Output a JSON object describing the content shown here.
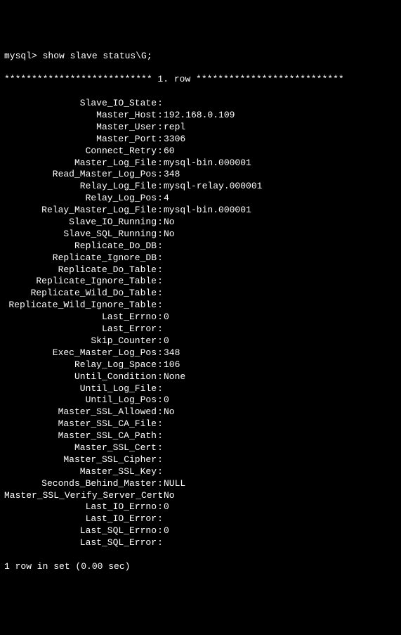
{
  "prompt": "mysql> show slave status\\G;",
  "row_header": "*************************** 1. row ***************************",
  "fields": [
    {
      "label": "Slave_IO_State",
      "value": ""
    },
    {
      "label": "Master_Host",
      "value": "192.168.0.109"
    },
    {
      "label": "Master_User",
      "value": "repl"
    },
    {
      "label": "Master_Port",
      "value": "3306"
    },
    {
      "label": "Connect_Retry",
      "value": "60"
    },
    {
      "label": "Master_Log_File",
      "value": "mysql-bin.000001"
    },
    {
      "label": "Read_Master_Log_Pos",
      "value": "348"
    },
    {
      "label": "Relay_Log_File",
      "value": "mysql-relay.000001"
    },
    {
      "label": "Relay_Log_Pos",
      "value": "4"
    },
    {
      "label": "Relay_Master_Log_File",
      "value": "mysql-bin.000001"
    },
    {
      "label": "Slave_IO_Running",
      "value": "No"
    },
    {
      "label": "Slave_SQL_Running",
      "value": "No"
    },
    {
      "label": "Replicate_Do_DB",
      "value": ""
    },
    {
      "label": "Replicate_Ignore_DB",
      "value": ""
    },
    {
      "label": "Replicate_Do_Table",
      "value": ""
    },
    {
      "label": "Replicate_Ignore_Table",
      "value": ""
    },
    {
      "label": "Replicate_Wild_Do_Table",
      "value": ""
    },
    {
      "label": "Replicate_Wild_Ignore_Table",
      "value": ""
    },
    {
      "label": "Last_Errno",
      "value": "0"
    },
    {
      "label": "Last_Error",
      "value": ""
    },
    {
      "label": "Skip_Counter",
      "value": "0"
    },
    {
      "label": "Exec_Master_Log_Pos",
      "value": "348"
    },
    {
      "label": "Relay_Log_Space",
      "value": "106"
    },
    {
      "label": "Until_Condition",
      "value": "None"
    },
    {
      "label": "Until_Log_File",
      "value": ""
    },
    {
      "label": "Until_Log_Pos",
      "value": "0"
    },
    {
      "label": "Master_SSL_Allowed",
      "value": "No"
    },
    {
      "label": "Master_SSL_CA_File",
      "value": ""
    },
    {
      "label": "Master_SSL_CA_Path",
      "value": ""
    },
    {
      "label": "Master_SSL_Cert",
      "value": ""
    },
    {
      "label": "Master_SSL_Cipher",
      "value": ""
    },
    {
      "label": "Master_SSL_Key",
      "value": ""
    },
    {
      "label": "Seconds_Behind_Master",
      "value": "NULL"
    },
    {
      "label": "Master_SSL_Verify_Server_Cert",
      "value": "No"
    },
    {
      "label": "Last_IO_Errno",
      "value": "0"
    },
    {
      "label": "Last_IO_Error",
      "value": ""
    },
    {
      "label": "Last_SQL_Errno",
      "value": "0"
    },
    {
      "label": "Last_SQL_Error",
      "value": ""
    }
  ],
  "footer": "1 row in set (0.00 sec)"
}
